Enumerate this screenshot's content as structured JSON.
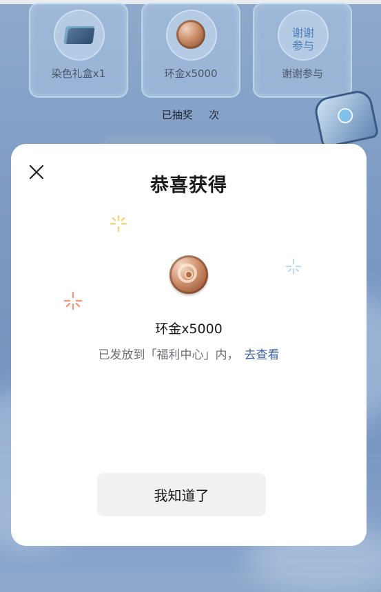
{
  "prizes": [
    {
      "label": "染色礼盒x1",
      "icon": "dye-gift-box-icon"
    },
    {
      "label": "环金x5000",
      "icon": "gold-coin-icon"
    },
    {
      "label": "谢谢参与",
      "icon_text": "谢谢\n参与"
    }
  ],
  "draw_status": {
    "prefix": "已抽奖",
    "count": "",
    "suffix": "次"
  },
  "modal": {
    "title": "恭喜获得",
    "reward_name": "环金x5000",
    "reward_desc": "已发放到「福利中心」内，",
    "view_link": "去查看",
    "confirm_label": "我知道了"
  },
  "colors": {
    "background": "#7e9bc4",
    "modal_bg": "#ffffff",
    "link": "#3e63a8",
    "button_bg": "#f1f1f1",
    "thanks_text": "#4a80b8"
  }
}
